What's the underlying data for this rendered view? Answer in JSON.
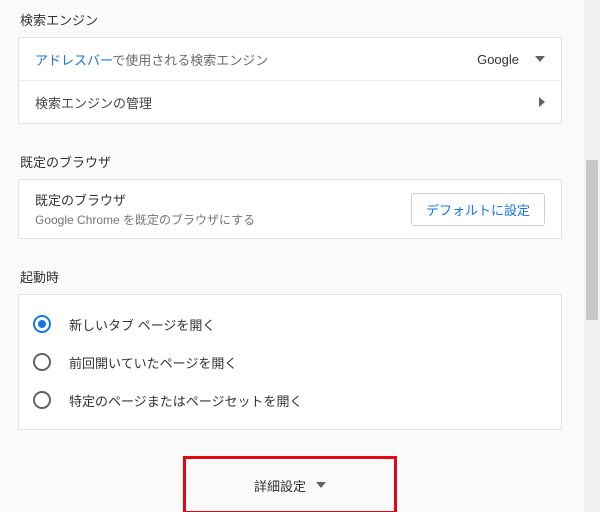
{
  "searchEngine": {
    "sectionTitle": "検索エンジン",
    "addressBarLink": "アドレスバー",
    "addressBarRest": "で使用される検索エンジン",
    "selectedEngine": "Google",
    "manageLabel": "検索エンジンの管理"
  },
  "defaultBrowser": {
    "sectionTitle": "既定のブラウザ",
    "title": "既定のブラウザ",
    "subtitle": "Google Chrome を既定のブラウザにする",
    "button": "デフォルトに設定"
  },
  "onStartup": {
    "sectionTitle": "起動時",
    "options": [
      {
        "label": "新しいタブ ページを開く",
        "selected": true
      },
      {
        "label": "前回開いていたページを開く",
        "selected": false
      },
      {
        "label": "特定のページまたはページセットを開く",
        "selected": false
      }
    ]
  },
  "advanced": {
    "label": "詳細設定"
  }
}
